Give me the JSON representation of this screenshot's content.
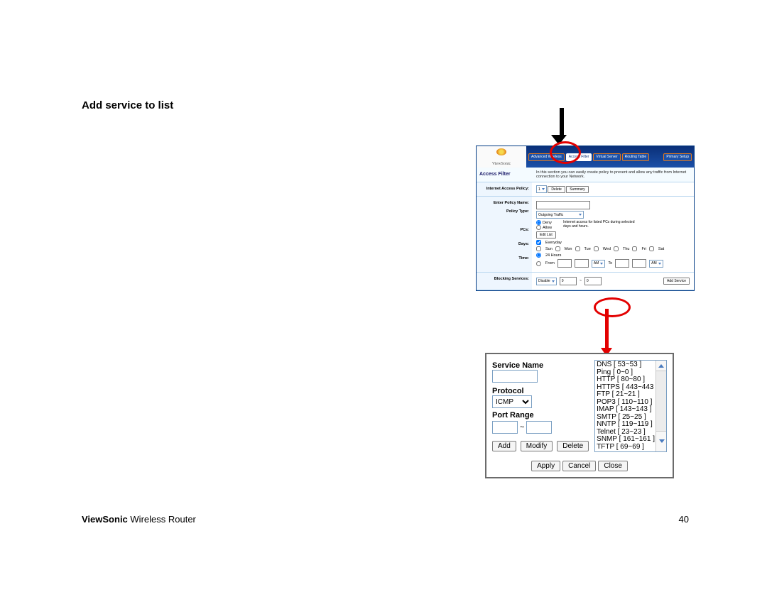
{
  "page": {
    "title": "Add service to list",
    "footer_brand_bold": "ViewSonic",
    "footer_brand_rest": " Wireless Router",
    "page_number": "40"
  },
  "router": {
    "brand": "ViewSonic",
    "tabs": {
      "advanced": "Advanced\nWireless",
      "access": "Access\nFilter",
      "virtual": "Virtual\nServer",
      "routing": "Routing\nTable",
      "primary": "Primary\nSetup"
    },
    "intro_label": "Access Filter",
    "intro_text": "In this section you can easily create policy to prevent and allow any traffic from Internet connection to your Network.",
    "policy_section_label": "Internet Access Policy:",
    "policy_number": "1",
    "delete_btn": "Delete",
    "summary_btn": "Summary",
    "enter_policy_name": "Enter Policy Name:",
    "policy_type_label": "Policy Type:",
    "policy_type_value": "Outgoing Traffic",
    "deny": "Deny",
    "allow": "Allow",
    "access_hint": "Internet access for listed PCs during selected days and hours.",
    "pcs_label": "PCs:",
    "editlist_btn": "Edit List",
    "everyday": "Everyday",
    "days_label": "Days:",
    "sun": "Sun",
    "mon": "Mon",
    "tue": "Tue",
    "wed": "Wed",
    "thu": "Thu",
    "fri": "Fri",
    "sat": "Sat",
    "time_label": "Time:",
    "twentyfour": "24 Hours",
    "from": "From",
    "to": "To",
    "am": "AM",
    "blocking_label": "Blocking Services:",
    "disable": "Disable",
    "zero": "0",
    "zero2": "0",
    "addservice_btn": "Add Service"
  },
  "dialog": {
    "service_name_label": "Service Name",
    "protocol_label": "Protocol",
    "protocol_value": "ICMP",
    "port_range_label": "Port Range",
    "tilde": "~",
    "add_btn": "Add",
    "modify_btn": "Modify",
    "delete_btn": "Delete",
    "apply_btn": "Apply",
    "cancel_btn": "Cancel",
    "close_btn": "Close",
    "services": [
      "DNS [ 53~53 ]",
      "Ping [ 0~0 ]",
      "HTTP [ 80~80 ]",
      "HTTPS [ 443~443 ]",
      "FTP [ 21~21 ]",
      "POP3 [ 110~110 ]",
      "IMAP [ 143~143 ]",
      "SMTP [ 25~25 ]",
      "NNTP [ 119~119 ]",
      "Telnet [ 23~23 ]",
      "SNMP [ 161~161 ]",
      "TFTP [ 69~69 ]"
    ]
  }
}
